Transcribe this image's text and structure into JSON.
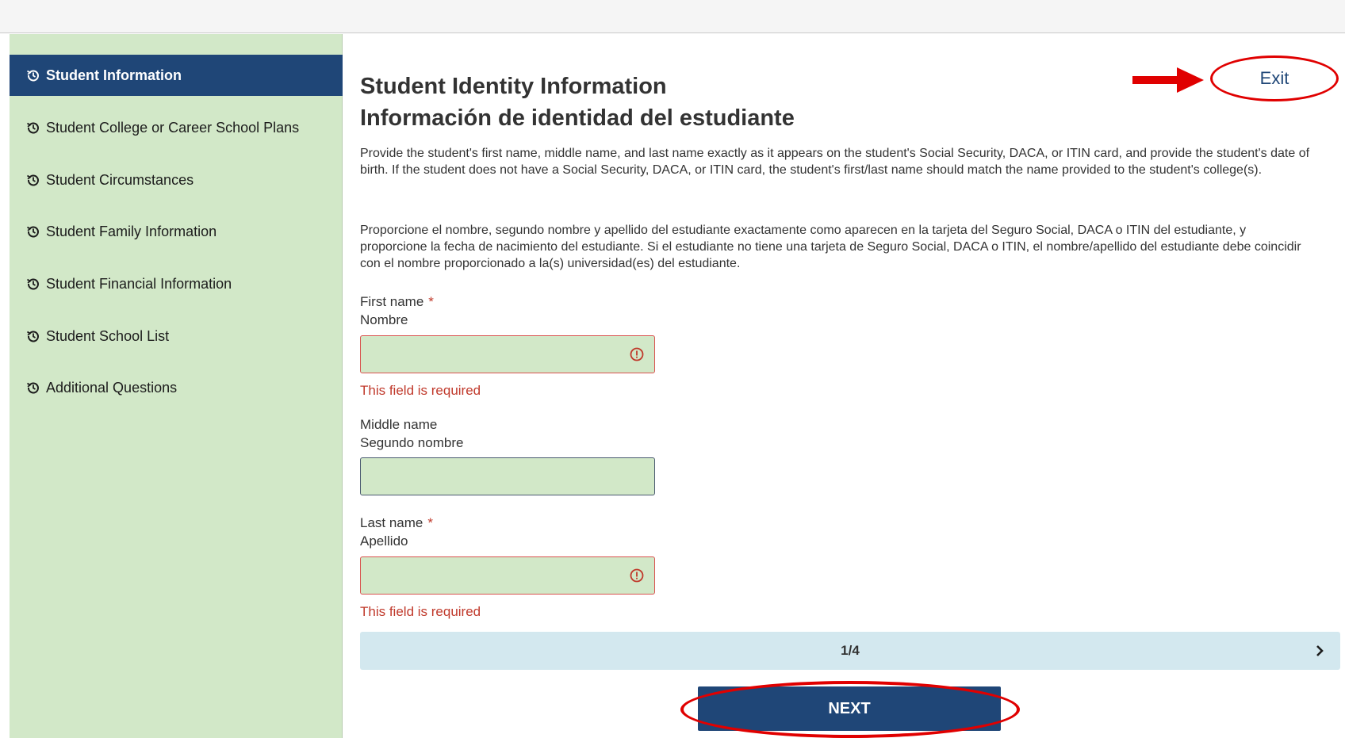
{
  "sidebar": {
    "items": [
      {
        "label": "Student Information",
        "active": true
      },
      {
        "label": "Student College or Career School Plans",
        "active": false
      },
      {
        "label": "Student Circumstances",
        "active": false
      },
      {
        "label": "Student Family Information",
        "active": false
      },
      {
        "label": "Student Financial Information",
        "active": false
      },
      {
        "label": "Student School List",
        "active": false
      },
      {
        "label": "Additional Questions",
        "active": false
      }
    ],
    "item_icon": "history-icon"
  },
  "main": {
    "title_en": "Student Identity Information",
    "title_es": "Información de identidad del estudiante",
    "exit_label": "Exit",
    "description_en": "Provide the student's first name, middle name, and last name exactly as it appears on the student's Social Security, DACA, or ITIN card, and provide the student's date of birth. If the student does not have a Social Security, DACA, or ITIN card, the student's first/last name should match the name provided to the student's college(s).",
    "description_es": "Proporcione el nombre, segundo nombre y apellido del estudiante exactamente como aparecen en la tarjeta del Seguro Social, DACA o ITIN del estudiante, y proporcione la fecha de nacimiento del estudiante. Si el estudiante no tiene una tarjeta de Seguro Social, DACA o ITIN, el nombre/apellido del estudiante debe coincidir con el nombre proporcionado a la(s) universidad(es) del estudiante.",
    "fields": {
      "first_name": {
        "label_en": "First name",
        "label_es": "Nombre",
        "required_mark": "*",
        "value": "",
        "error": "This field is required"
      },
      "middle_name": {
        "label_en": "Middle name",
        "label_es": "Segundo nombre",
        "value": ""
      },
      "last_name": {
        "label_en": "Last name",
        "label_es": "Apellido",
        "required_mark": "*",
        "value": "",
        "error": "This field is required"
      }
    },
    "pager": {
      "text": "1/4"
    },
    "next_label": "NEXT"
  },
  "colors": {
    "sidebar_bg": "#d2e8c8",
    "active_nav_bg": "#1f4677",
    "error": "#c0392b",
    "annotation_red": "#e00000",
    "pager_bg": "#d3e8ef"
  }
}
